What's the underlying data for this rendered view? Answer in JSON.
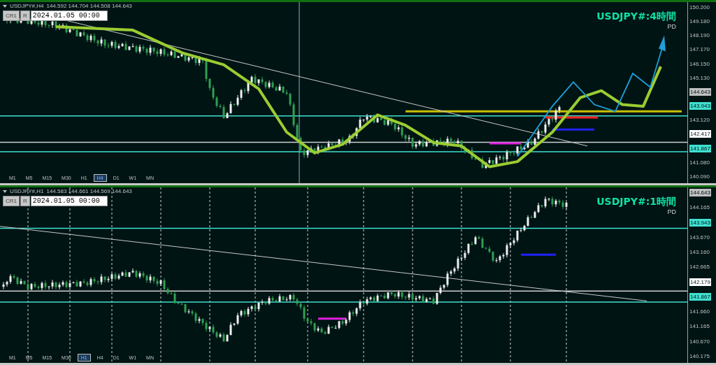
{
  "panels": [
    {
      "header": {
        "symbol": "USDJPY#,H4",
        "quotes": "144.592 144.704 144.508 144.643"
      },
      "buttons": [
        "CR1",
        "R"
      ],
      "date_field": "2024.01.05 00:00",
      "title": "USDJPY#:4時間",
      "subtitle": "PD",
      "price_axis": [
        {
          "kind": "label",
          "text": "150.200"
        },
        {
          "kind": "label",
          "text": "149.180"
        },
        {
          "kind": "label",
          "text": "148.190"
        },
        {
          "kind": "label",
          "text": "147.170"
        },
        {
          "kind": "label",
          "text": "146.150"
        },
        {
          "kind": "label",
          "text": "145.130"
        },
        {
          "kind": "tag",
          "text": "144.643",
          "color": "#c0c0c0"
        },
        {
          "kind": "tag",
          "text": "143.943",
          "color": "#40e0d0"
        },
        {
          "kind": "label",
          "text": "143.120"
        },
        {
          "kind": "tag",
          "text": "142.417",
          "color": "#ffffff"
        },
        {
          "kind": "tag",
          "text": "141.867",
          "color": "#40e0d0"
        },
        {
          "kind": "label",
          "text": "141.080"
        },
        {
          "kind": "label",
          "text": "140.090"
        }
      ],
      "timeframes": [
        {
          "label": "M1",
          "selected": false
        },
        {
          "label": "M5",
          "selected": false
        },
        {
          "label": "M15",
          "selected": false
        },
        {
          "label": "M30",
          "selected": false
        },
        {
          "label": "H1",
          "selected": false
        },
        {
          "label": "H4",
          "selected": true
        },
        {
          "label": "D1",
          "selected": false
        },
        {
          "label": "W1",
          "selected": false
        },
        {
          "label": "MN",
          "selected": false
        }
      ]
    },
    {
      "header": {
        "symbol": "USDJPY#,H1",
        "quotes": "144.583 144.661 144.569 144.643"
      },
      "buttons": [
        "CR1",
        "R"
      ],
      "date_field": "2024.01.05 00:00",
      "title": "USDJPY#:1時間",
      "subtitle": "PD",
      "price_axis": [
        {
          "kind": "tag",
          "text": "144.643",
          "color": "#c0c0c0"
        },
        {
          "kind": "label",
          "text": "144.165"
        },
        {
          "kind": "tag",
          "text": "143.943",
          "color": "#40e0d0"
        },
        {
          "kind": "label",
          "text": "143.670"
        },
        {
          "kind": "label",
          "text": "143.160"
        },
        {
          "kind": "label",
          "text": "142.665"
        },
        {
          "kind": "tag",
          "text": "142.179",
          "color": "#ffffff"
        },
        {
          "kind": "tag",
          "text": "141.867",
          "color": "#40e0d0"
        },
        {
          "kind": "label",
          "text": "141.660"
        },
        {
          "kind": "label",
          "text": "141.165"
        },
        {
          "kind": "label",
          "text": "140.670"
        },
        {
          "kind": "label",
          "text": "140.175"
        }
      ],
      "timeframes": [
        {
          "label": "M1",
          "selected": false
        },
        {
          "label": "M5",
          "selected": false
        },
        {
          "label": "M15",
          "selected": false
        },
        {
          "label": "M30",
          "selected": false
        },
        {
          "label": "H1",
          "selected": true
        },
        {
          "label": "H4",
          "selected": false
        },
        {
          "label": "D1",
          "selected": false
        },
        {
          "label": "W1",
          "selected": false
        },
        {
          "label": "MN",
          "selected": false
        }
      ]
    }
  ]
}
